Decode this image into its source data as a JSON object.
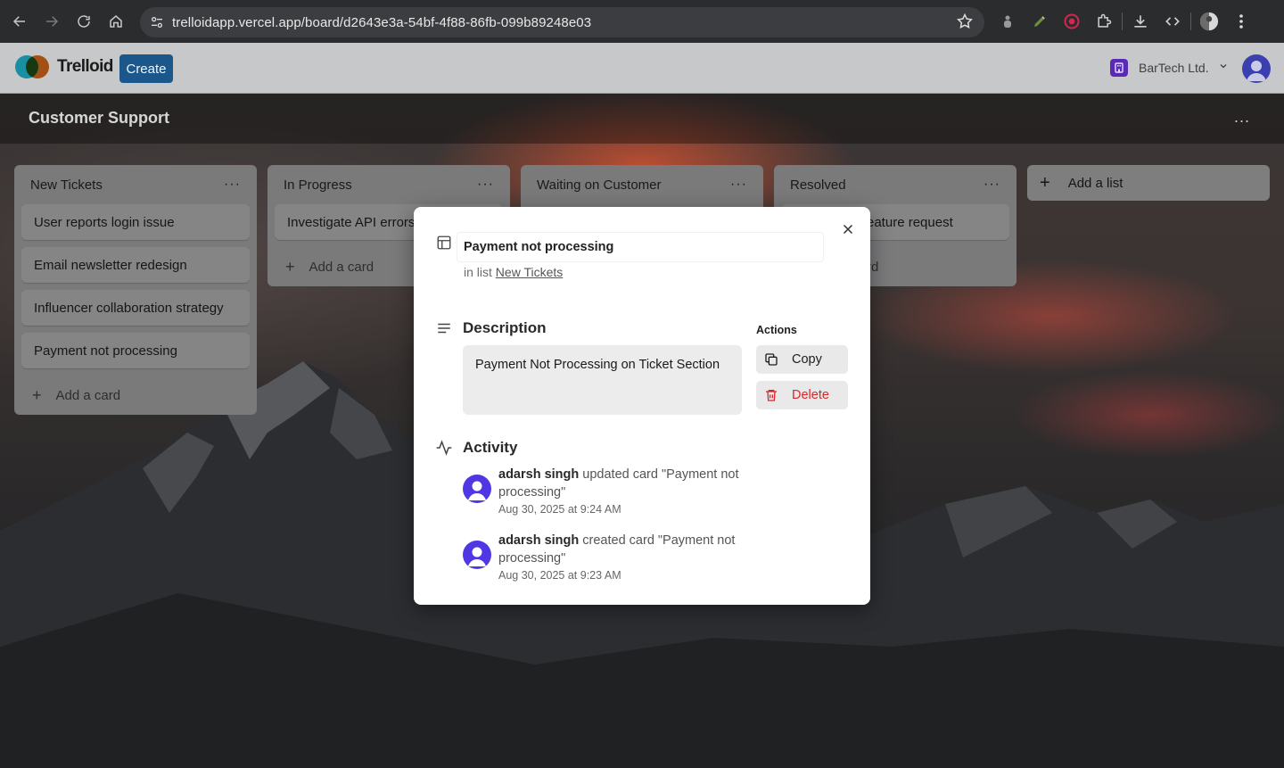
{
  "browser": {
    "url": "trelloidapp.vercel.app/board/d2643e3a-54bf-4f88-86fb-099b89248e03"
  },
  "app": {
    "name": "Trelloid",
    "create_label": "Create",
    "org_name": "BarTech Ltd."
  },
  "board": {
    "title": "Customer Support",
    "menu_label": "...",
    "add_list_label": "Add a list",
    "lists": [
      {
        "title": "New Tickets",
        "cards": [
          "User reports login issue",
          "Email newsletter redesign",
          "Influencer collaboration strategy",
          "Payment not processing"
        ],
        "add_card_label": "Add a card"
      },
      {
        "title": "In Progress",
        "cards": [
          "Investigate API errors"
        ],
        "add_card_label": "Add a card"
      },
      {
        "title": "Waiting on Customer",
        "cards": [],
        "add_card_label": ""
      },
      {
        "title": "Resolved",
        "cards": [
          "eature request"
        ],
        "add_card_label": "rd"
      }
    ]
  },
  "modal": {
    "title": "Payment not processing",
    "in_list_prefix": "in list",
    "list_name": "New Tickets",
    "description_title": "Description",
    "description_text": "Payment Not Processing on Ticket Section",
    "actions_title": "Actions",
    "copy_label": "Copy",
    "delete_label": "Delete",
    "activity_title": "Activity",
    "activity": [
      {
        "user": "adarsh singh",
        "text": "updated card \"Payment not processing\"",
        "time": "Aug 30, 2025 at 9:24 AM"
      },
      {
        "user": "adarsh singh",
        "text": "created card \"Payment not processing\"",
        "time": "Aug 30, 2025 at 9:23 AM"
      }
    ]
  },
  "colors": {
    "create_button": "#1b578a",
    "delete_text": "#d8262b",
    "avatar": "#4f38e4"
  }
}
